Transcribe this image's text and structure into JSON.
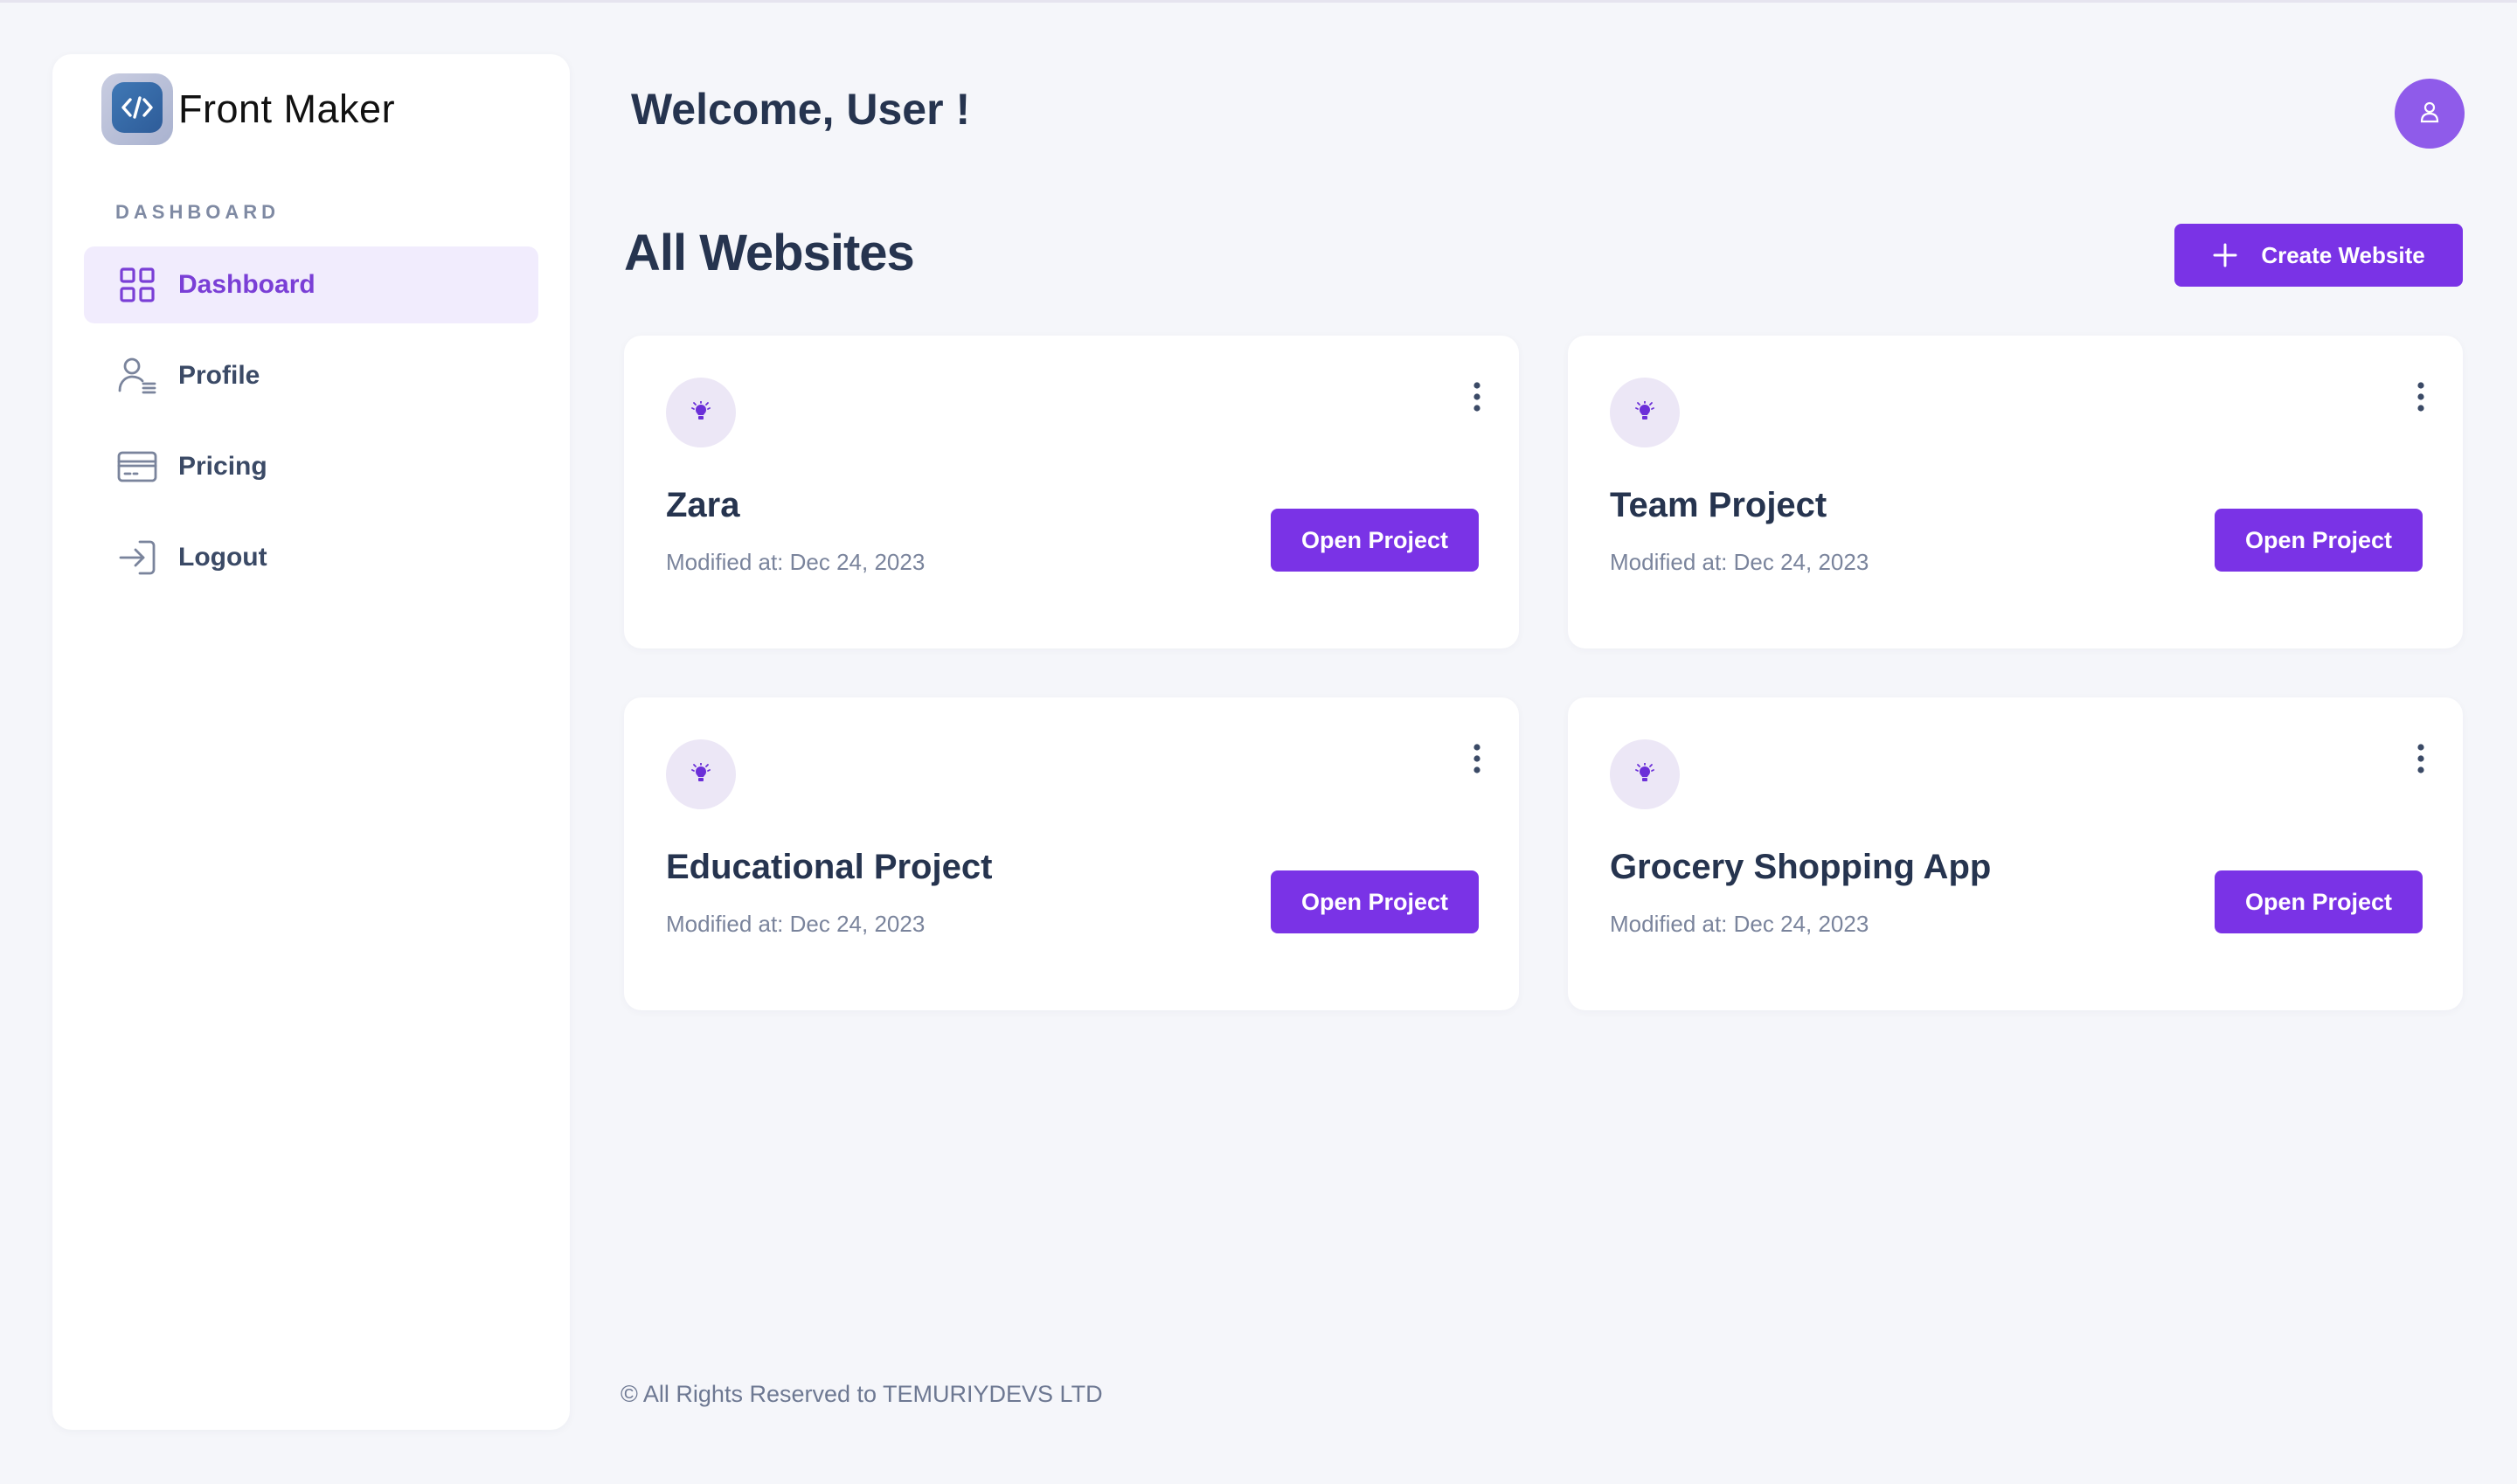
{
  "brand": {
    "name": "Front Maker",
    "logo_icon": "code-icon"
  },
  "sidebar": {
    "section_label": "DASHBOARD",
    "items": [
      {
        "label": "Dashboard",
        "icon": "grid-icon",
        "active": true
      },
      {
        "label": "Profile",
        "icon": "user-list-icon",
        "active": false
      },
      {
        "label": "Pricing",
        "icon": "credit-card-icon",
        "active": false
      },
      {
        "label": "Logout",
        "icon": "logout-icon",
        "active": false
      }
    ]
  },
  "header": {
    "welcome": "Welcome, User !",
    "avatar_icon": "user-icon"
  },
  "main": {
    "title": "All Websites",
    "create_button": "Create Website",
    "projects": [
      {
        "name": "Zara",
        "modified": "Modified at: Dec 24, 2023",
        "button": "Open Project"
      },
      {
        "name": "Team Project",
        "modified": "Modified at: Dec 24, 2023",
        "button": "Open Project"
      },
      {
        "name": "Educational Project",
        "modified": "Modified at: Dec 24, 2023",
        "button": "Open Project"
      },
      {
        "name": "Grocery Shopping App",
        "modified": "Modified at: Dec 24, 2023",
        "button": "Open Project"
      }
    ]
  },
  "footer": {
    "text": "© All Rights Reserved to TEMURIYDEVS LTD"
  },
  "colors": {
    "accent": "#7a33e6",
    "active_nav_bg": "#f1ecfd",
    "active_nav_text": "#7a3fd6",
    "avatar": "#8f5bea",
    "page_bg": "#f5f6fa"
  }
}
